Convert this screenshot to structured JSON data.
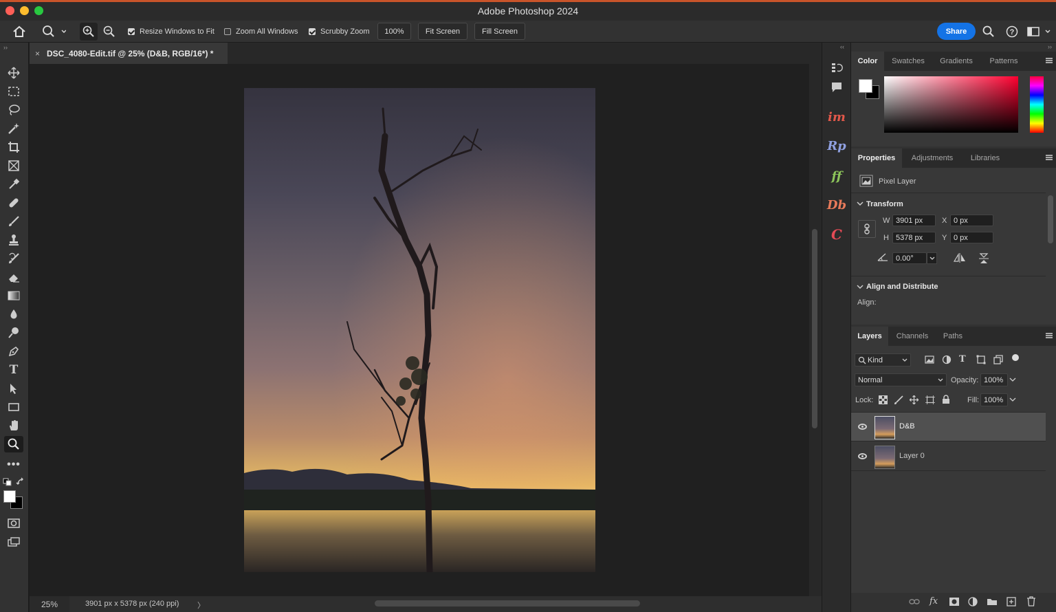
{
  "window": {
    "title": "Adobe Photoshop 2024"
  },
  "options_bar": {
    "resize_windows": {
      "label": "Resize Windows to Fit",
      "checked": true
    },
    "zoom_all": {
      "label": "Zoom All Windows",
      "checked": false
    },
    "scrubby_zoom": {
      "label": "Scrubby Zoom",
      "checked": true
    },
    "zoom_value": "100%",
    "fit_screen": "Fit Screen",
    "fill_screen": "Fill Screen",
    "share": "Share"
  },
  "document": {
    "tab_title": "DSC_4080-Edit.tif @ 25% (D&B, RGB/16*) *",
    "close": "×"
  },
  "status": {
    "zoom": "25%",
    "dimensions": "3901 px x 5378 px (240 ppi)",
    "arrow": "〉"
  },
  "plugins": [
    "im",
    "Rp",
    "ff",
    "Db",
    "C"
  ],
  "color_panel": {
    "tabs": [
      "Color",
      "Swatches",
      "Gradients",
      "Patterns"
    ],
    "active_tab": "Color",
    "hue": "#ff0030"
  },
  "properties": {
    "tabs": [
      "Properties",
      "Adjustments",
      "Libraries"
    ],
    "layer_type": "Pixel Layer",
    "transform_header": "Transform",
    "w_label": "W",
    "w_value": "3901 px",
    "h_label": "H",
    "h_value": "5378 px",
    "x_label": "X",
    "x_value": "0 px",
    "y_label": "Y",
    "y_value": "0 px",
    "angle_value": "0.00°",
    "align_header": "Align and Distribute",
    "align_label": "Align:"
  },
  "layers_panel": {
    "tabs": [
      "Layers",
      "Channels",
      "Paths"
    ],
    "filter_kind": "Kind",
    "blend_mode": "Normal",
    "opacity_label": "Opacity:",
    "opacity_value": "100%",
    "lock_label": "Lock:",
    "fill_label": "Fill:",
    "fill_value": "100%",
    "layers": [
      {
        "name": "D&B",
        "visible": true,
        "selected": true
      },
      {
        "name": "Layer 0",
        "visible": true,
        "selected": false
      }
    ],
    "footer_icons": [
      "link-icon",
      "fx-icon",
      "mask-icon",
      "adjustment-icon",
      "folder-icon",
      "new-layer-icon",
      "trash-icon"
    ],
    "fx_label": "fx"
  }
}
